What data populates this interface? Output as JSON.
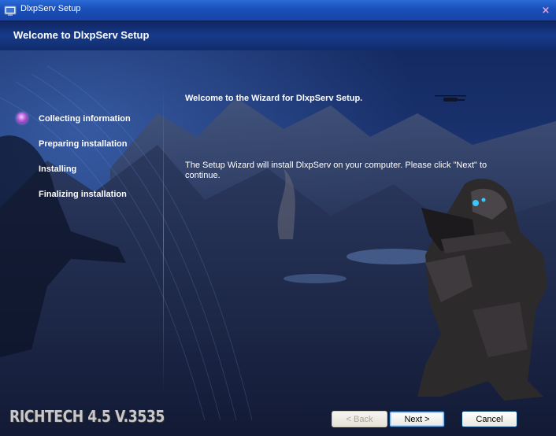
{
  "window": {
    "title": "DlxpServ Setup",
    "close_glyph": "×",
    "app_icon": "setup-app-icon",
    "close_icon": "close-icon"
  },
  "header": {
    "title": "Welcome to DlxpServ Setup"
  },
  "steps": [
    {
      "label": "Collecting information",
      "active": true
    },
    {
      "label": "Preparing installation",
      "active": false
    },
    {
      "label": "Installing",
      "active": false
    },
    {
      "label": "Finalizing installation",
      "active": false
    }
  ],
  "content": {
    "title": "Welcome to the Wizard for DlxpServ Setup.",
    "body": "The Setup Wizard will install DlxpServ on your computer.  Please click \"Next\" to continue."
  },
  "branding": {
    "text": "RICHTECH 4.5 V.3535"
  },
  "buttons": {
    "back": "< Back",
    "next": "Next >",
    "cancel": "Cancel"
  },
  "colors": {
    "titlebar": "#1a4fb8",
    "header": "#163a8a",
    "active_step_marker": "#b55bd8",
    "text": "#ffffff"
  }
}
